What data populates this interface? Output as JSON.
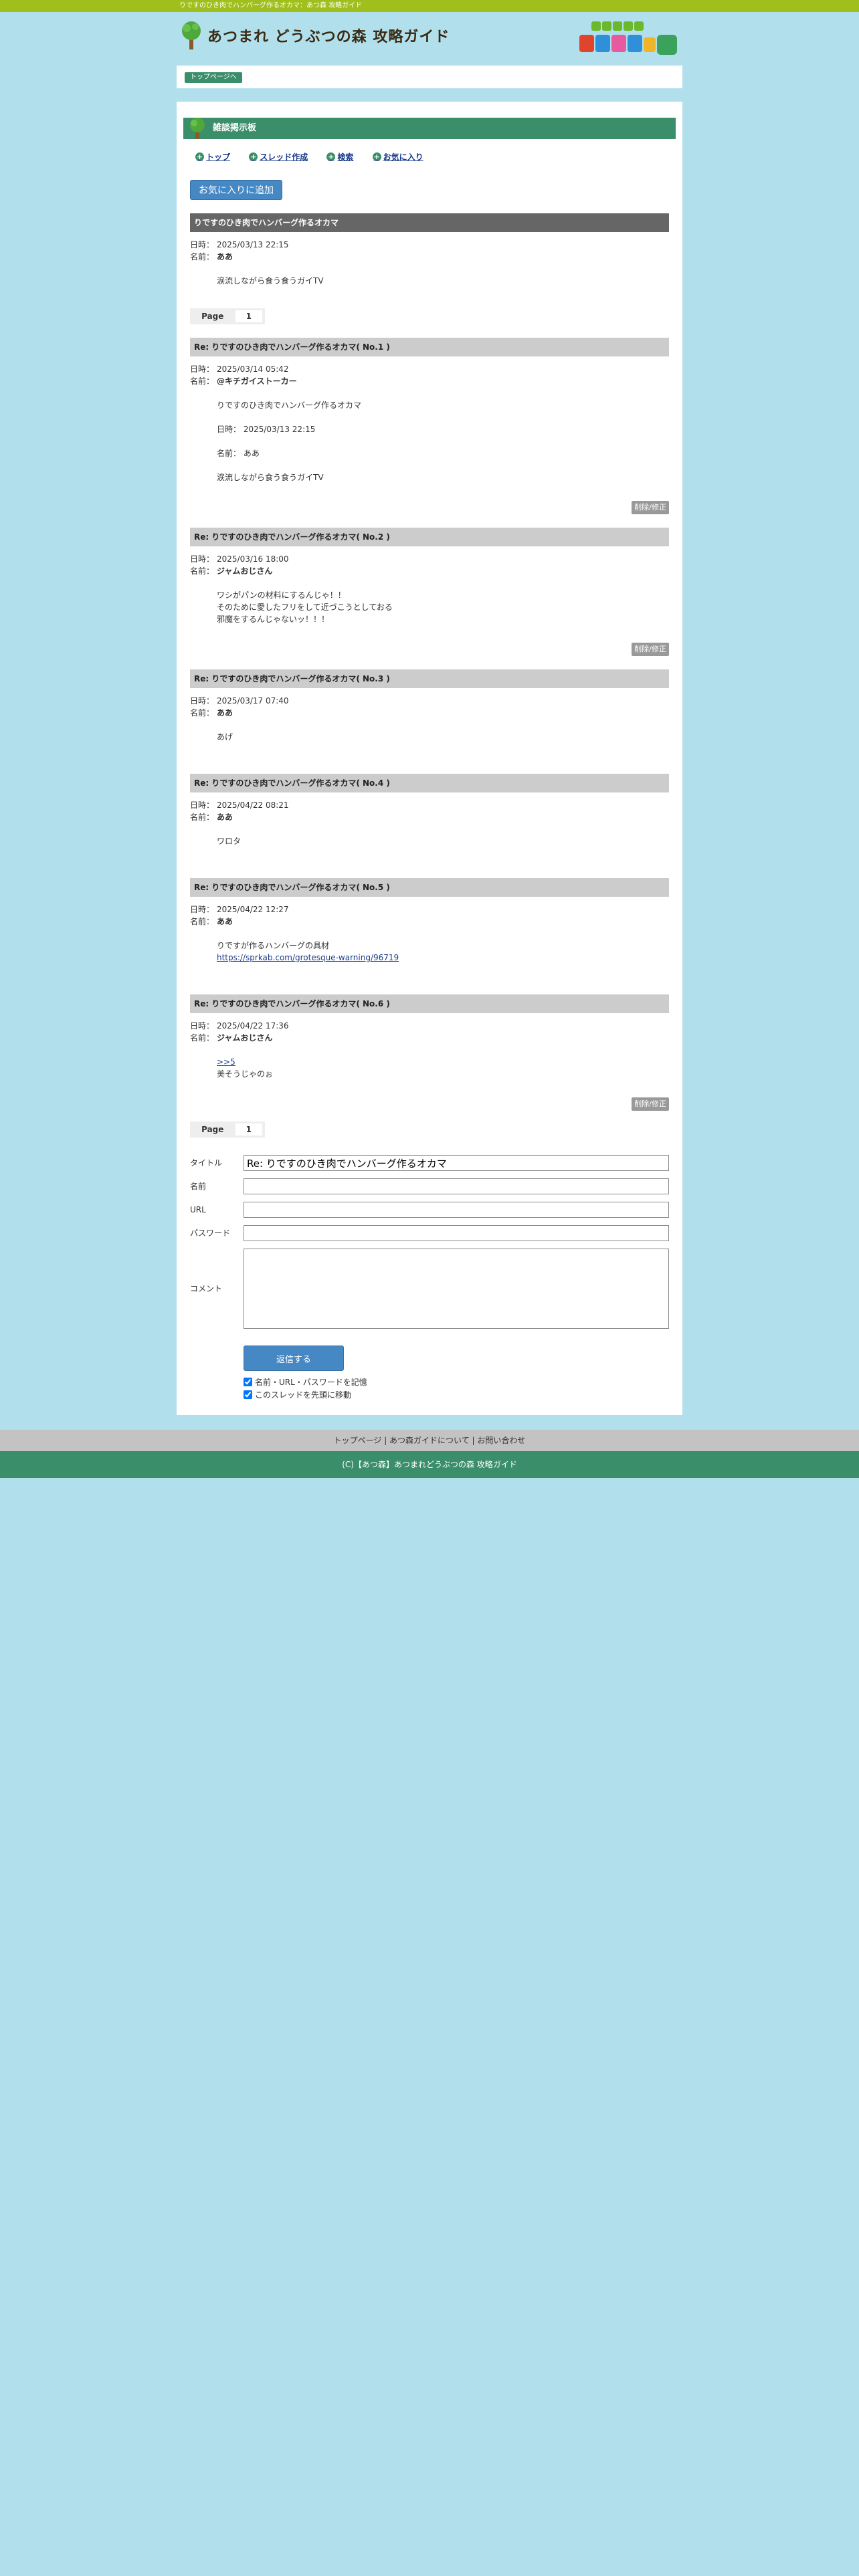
{
  "topbar": {
    "text": "りですのひき肉でハンバーグ作るオカマ：あつ森 攻略ガイド"
  },
  "header": {
    "site_title": "あつまれ どうぶつの森 攻略ガイド",
    "badge_line1": "あつまれ",
    "badge_line2": "どうぶつの森"
  },
  "breadcrumb": {
    "top_label": "トップページへ"
  },
  "board": {
    "title": "雑談掲示板"
  },
  "nav": {
    "items": [
      {
        "label": "トップ"
      },
      {
        "label": "スレッド作成"
      },
      {
        "label": "検索"
      },
      {
        "label": "お気に入り"
      }
    ]
  },
  "fav_button": "お気に入りに追加",
  "labels": {
    "date": "日時：",
    "name": "名前：",
    "edit": "削除/修正"
  },
  "thread": {
    "title": "りですのひき肉でハンバーグ作るオカマ",
    "date": "2025/03/13 22:15",
    "name": "ああ",
    "body": "涙流しながら食う食うガイTV"
  },
  "pager": {
    "label": "Page",
    "current": "1"
  },
  "replies": [
    {
      "title": "Re: りですのひき肉でハンバーグ作るオカマ( No.1 )",
      "date": "2025/03/14 05:42",
      "name": "@キチガイストーカー",
      "lines": [
        "りですのひき肉でハンバーグ作るオカマ",
        "",
        "日時： 2025/03/13 22:15",
        "",
        "名前： ああ",
        "",
        "涙流しながら食う食うガイTV"
      ]
    },
    {
      "title": "Re: りですのひき肉でハンバーグ作るオカマ( No.2 )",
      "date": "2025/03/16 18:00",
      "name": "ジャムおじさん",
      "lines": [
        "ワシがパンの材料にするんじゃ！！",
        "そのために愛したフリをして近づこうとしておる",
        "邪魔をするんじゃないッ！！！"
      ]
    },
    {
      "title": "Re: りですのひき肉でハンバーグ作るオカマ( No.3 )",
      "date": "2025/03/17 07:40",
      "name": "ああ",
      "lines": [
        "あげ"
      ]
    },
    {
      "title": "Re: りですのひき肉でハンバーグ作るオカマ( No.4 )",
      "date": "2025/04/22 08:21",
      "name": "ああ",
      "lines": [
        "ワロタ"
      ]
    },
    {
      "title": "Re: りですのひき肉でハンバーグ作るオカマ( No.5 )",
      "date": "2025/04/22 12:27",
      "name": "ああ",
      "lines": [
        "りですが作るハンバーグの具材"
      ],
      "link": "https://sprkab.com/grotesque-warning/96719"
    },
    {
      "title": "Re: りですのひき肉でハンバーグ作るオカマ( No.6 )",
      "date": "2025/04/22 17:36",
      "name": "ジャムおじさん",
      "link_first": ">>5",
      "lines": [
        "美そうじゃのぉ"
      ]
    }
  ],
  "form": {
    "title_label": "タイトル",
    "title_value": "Re: りですのひき肉でハンバーグ作るオカマ",
    "name_label": "名前",
    "url_label": "URL",
    "password_label": "パスワード",
    "comment_label": "コメント",
    "submit_label": "返信する",
    "remember_label": "名前・URL・パスワードを記憶",
    "top_label": "このスレッドを先頭に移動"
  },
  "footer": {
    "links_text": "トップページ | あつ森ガイドについて | お問い合わせ",
    "copyright": "(C)【あつ森】あつまれどうぶつの森 攻略ガイド"
  },
  "colors": {
    "green": "#3b8e6a",
    "topbar": "#9fc01c",
    "background": "#b1dfec",
    "button_blue": "#4688c4"
  }
}
